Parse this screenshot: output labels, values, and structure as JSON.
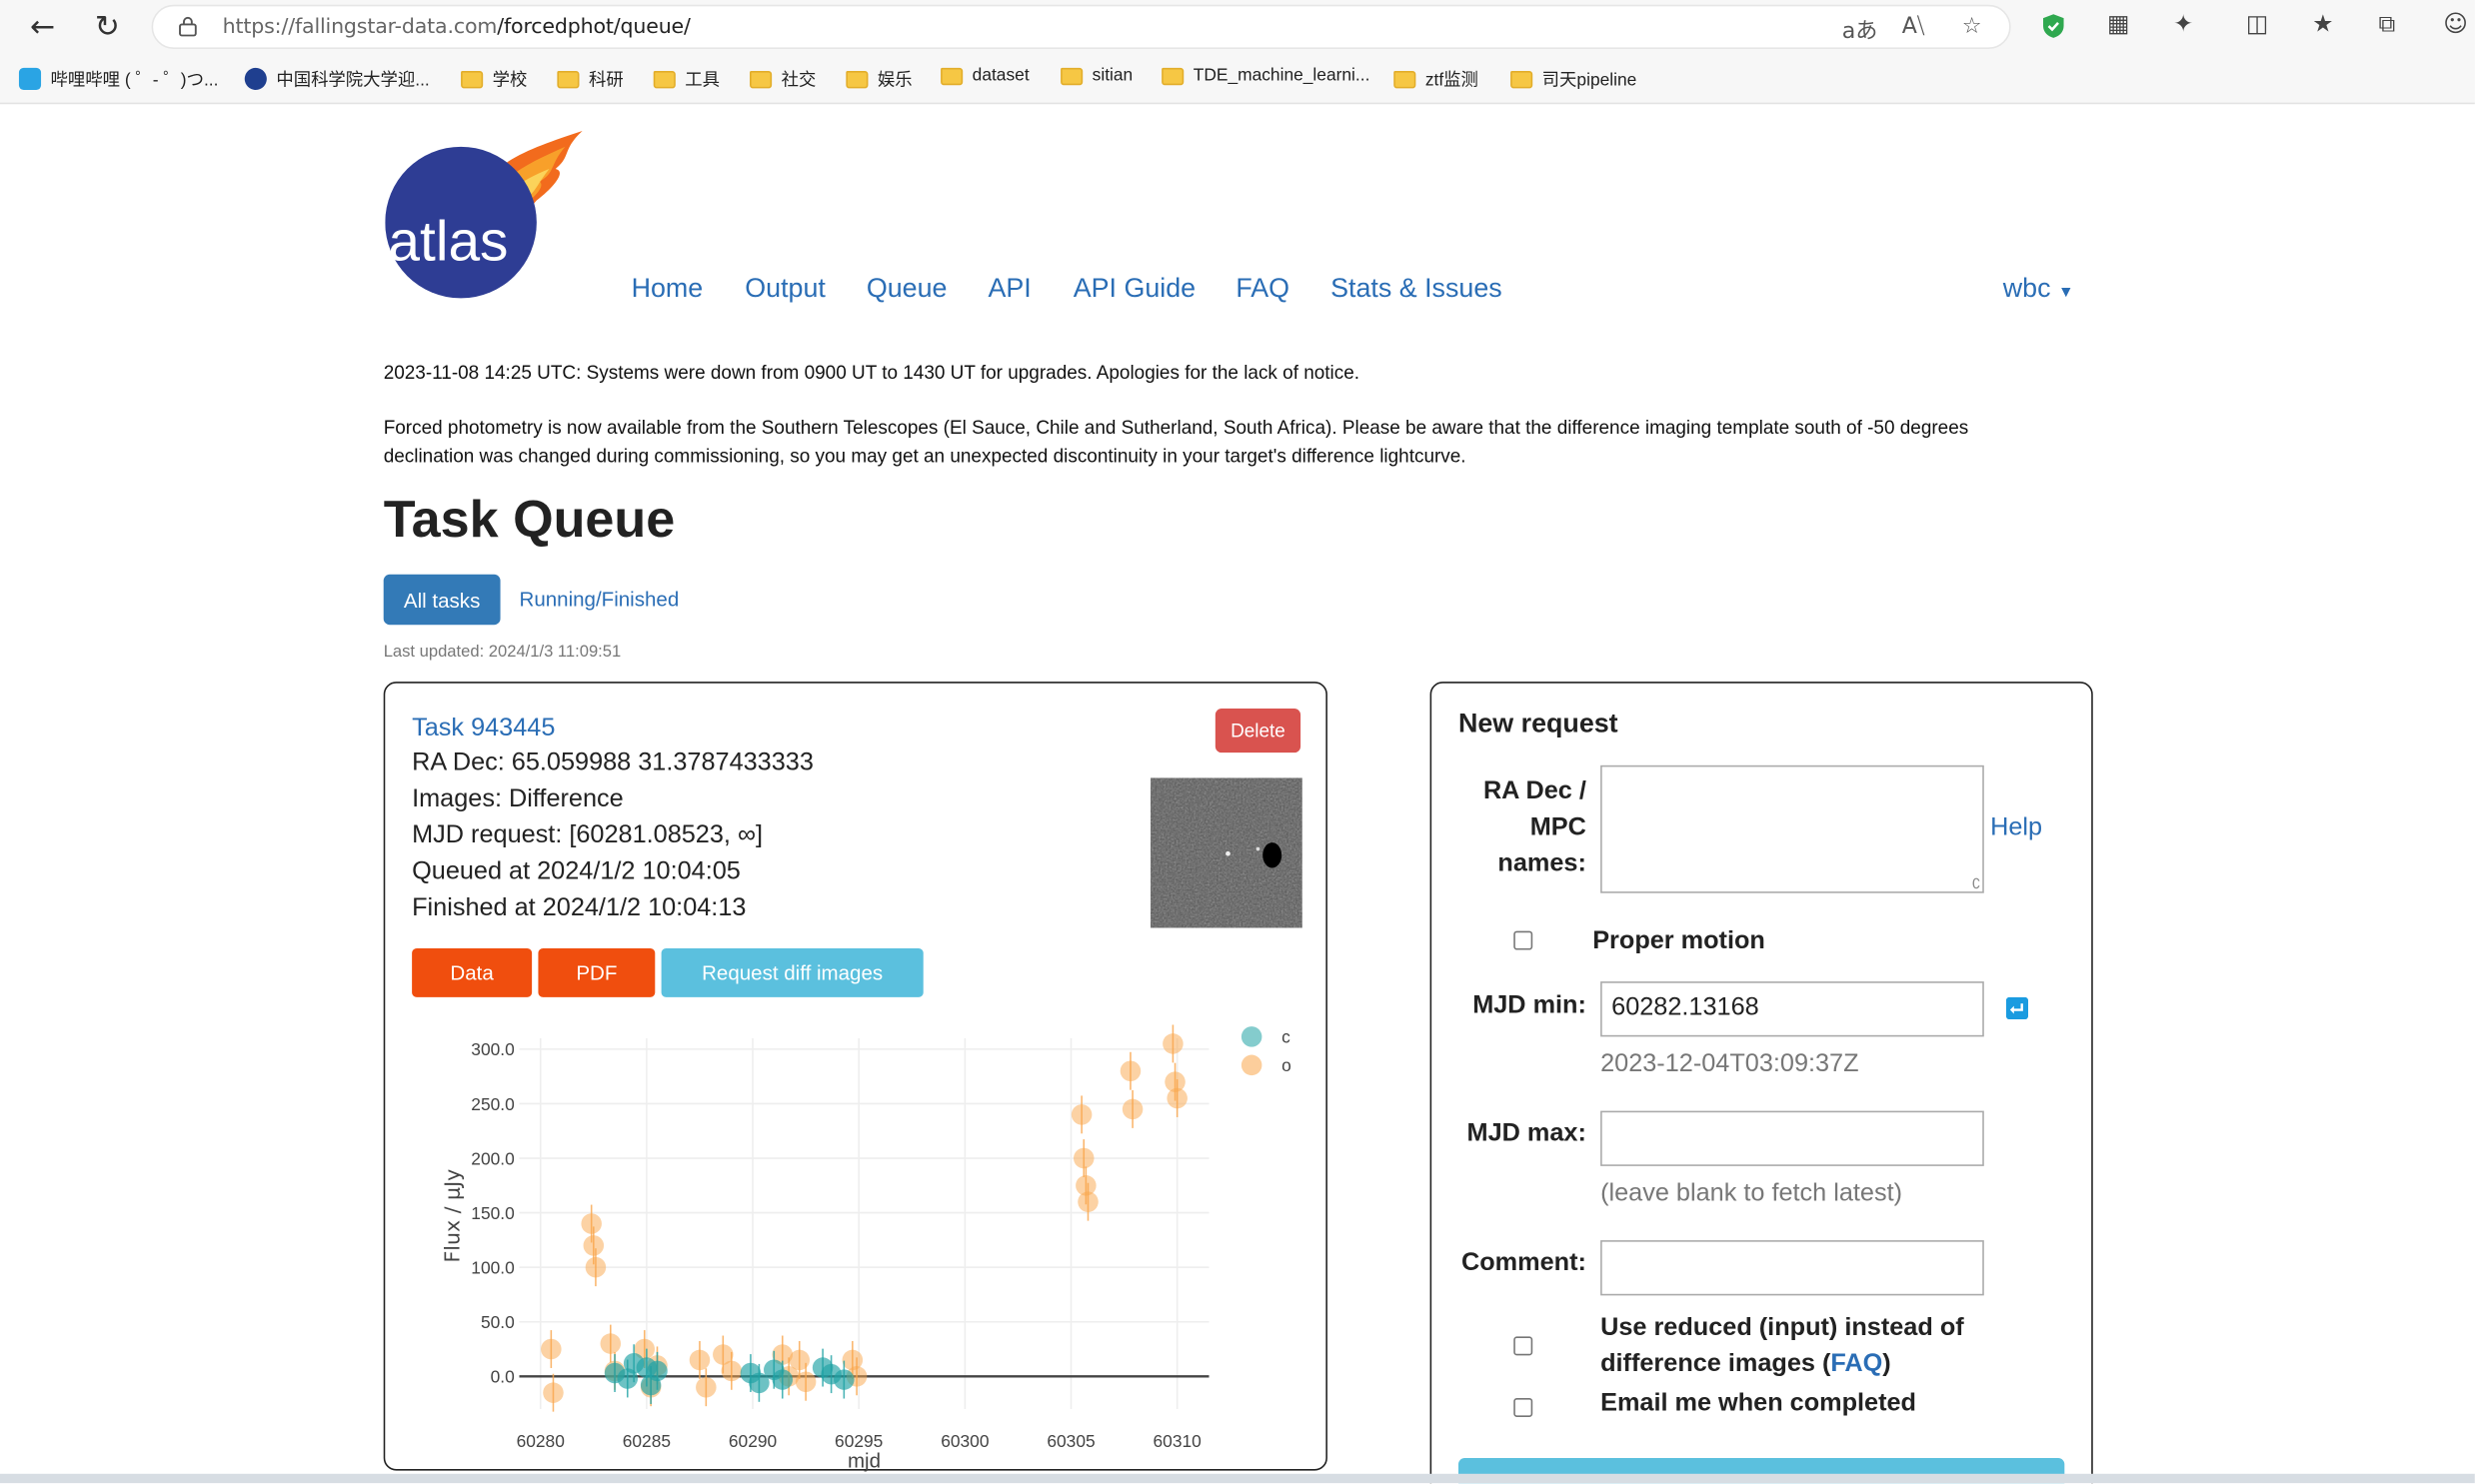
{
  "browser": {
    "url_host": "https://fallingstar-data.com",
    "url_path": "/forcedphot/queue/",
    "bookmarks": [
      "哔哩哔哩 ( ゜- ゜)つ...",
      "中国科学院大学迎...",
      "学校",
      "科研",
      "工具",
      "社交",
      "娱乐",
      "dataset",
      "sitian",
      "TDE_machine_learni...",
      "ztf监测",
      "司天pipeline"
    ]
  },
  "logo": {
    "text": "atlas"
  },
  "nav": {
    "items": [
      "Home",
      "Output",
      "Queue",
      "API",
      "API Guide",
      "FAQ",
      "Stats & Issues"
    ],
    "user": "wbc"
  },
  "notices": [
    "2023-11-08 14:25 UTC: Systems were down from 0900 UT to 1430 UT for upgrades. Apologies for the lack of notice.",
    "Forced photometry is now available from the Southern Telescopes (El Sauce, Chile and Sutherland, South Africa). Please be aware that the difference imaging template south of -50 degrees declination was changed during commissioning, so you may get an unexpected discontinuity in your target's difference lightcurve."
  ],
  "page_title": "Task Queue",
  "filters": {
    "active": "All tasks",
    "other": "Running/Finished"
  },
  "last_updated": "Last updated: 2024/1/3 11:09:51",
  "task": {
    "title": "Task 943445",
    "lines": [
      "RA Dec: 65.059988 31.3787433333",
      "Images: Difference",
      "MJD request: [60281.08523, ∞]",
      "Queued at 2024/1/2 10:04:05",
      "Finished at 2024/1/2 10:04:13"
    ],
    "delete_label": "Delete",
    "buttons": [
      "Data",
      "PDF",
      "Request diff images"
    ]
  },
  "colors": {
    "link": "#2a6db5",
    "primary": "#337ab7",
    "danger": "#d9534f",
    "orange": "#f04e0e",
    "info": "#5bc0de",
    "series_c": "#1fa2a4",
    "series_o": "#f9a54a"
  },
  "chart_data": {
    "type": "scatter",
    "xlabel": "mjd",
    "ylabel": "Flux / μJy",
    "xlim": [
      60279.0,
      60311.5
    ],
    "ylim": [
      -30,
      310
    ],
    "xticks": [
      60280,
      60285,
      60290,
      60295,
      60300,
      60305,
      60310
    ],
    "yticks": [
      0,
      50,
      100,
      150,
      200,
      250,
      300
    ],
    "ytick_labels": [
      "0.0",
      "50.0",
      "100.0",
      "150.0",
      "200.0",
      "250.0",
      "300.0"
    ],
    "xtick_labels": [
      "60280",
      "60285",
      "60290",
      "60295",
      "60300",
      "60305",
      "60310"
    ],
    "grid": true,
    "legend": "top-right",
    "series": [
      {
        "name": "c",
        "x": [
          60283.5,
          60284.1,
          60284.4,
          60285.0,
          60285.2,
          60285.5,
          60289.9,
          60290.3,
          60291.0,
          60291.4,
          60293.3,
          60293.7,
          60294.3
        ],
        "y": [
          3,
          -2,
          12,
          8,
          -8,
          5,
          3,
          -6,
          6,
          -3,
          8,
          2,
          -3
        ]
      },
      {
        "name": "o",
        "x": [
          60280.5,
          60280.6,
          60282.4,
          60282.5,
          60282.6,
          60283.3,
          60283.5,
          60284.9,
          60285.2,
          60285.5,
          60287.5,
          60287.8,
          60288.6,
          60289.0,
          60291.4,
          60291.7,
          60292.2,
          60292.5,
          60294.7,
          60294.9,
          60305.5,
          60305.6,
          60305.7,
          60305.8,
          60307.8,
          60307.9,
          60309.8,
          60309.9,
          60310.0
        ],
        "y": [
          25,
          -15,
          140,
          120,
          100,
          30,
          5,
          25,
          -10,
          10,
          15,
          -10,
          20,
          5,
          20,
          0,
          15,
          -5,
          15,
          0,
          240,
          200,
          175,
          160,
          280,
          245,
          305,
          270,
          255
        ]
      }
    ]
  },
  "form": {
    "title": "New request",
    "radec_label": [
      "RA Dec /",
      "MPC",
      "names:"
    ],
    "help": "Help",
    "proper_motion": "Proper motion",
    "mjd_min_label": "MJD min:",
    "mjd_min_value": "60282.13168",
    "mjd_min_hint": "2023-12-04T03:09:37Z",
    "mjd_max_label": "MJD max:",
    "mjd_max_hint": "(leave blank to fetch latest)",
    "comment_label": "Comment:",
    "reduced_pre": "Use reduced (input) instead of",
    "reduced_mid": "difference images (",
    "reduced_link": "FAQ",
    "reduced_post": ")",
    "email": "Email me when completed"
  }
}
